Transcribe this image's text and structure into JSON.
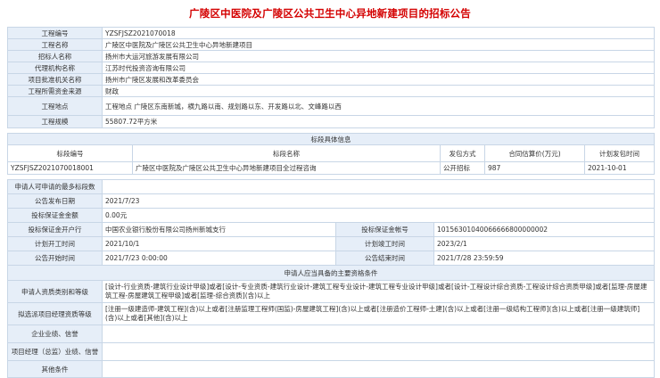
{
  "title": "广陵区中医院及广陵区公共卫生中心异地新建项目的招标公告",
  "info": [
    {
      "label": "工程编号",
      "value": "YZSFJSZ2021070018"
    },
    {
      "label": "工程名称",
      "value": "广陵区中医院及广陵区公共卫生中心异地新建项目"
    },
    {
      "label": "招标人名称",
      "value": "扬州市大运河旅游发展有限公司"
    },
    {
      "label": "代理机构名称",
      "value": "江苏时代投资咨询有限公司"
    },
    {
      "label": "项目批准机关名称",
      "value": "扬州市广陵区发展和改革委员会"
    },
    {
      "label": "工程所需资金来源",
      "value": "财政"
    },
    {
      "label": "工程地点",
      "value": "工程地点 广陵区东南新城，横九路以南、规划路以东、开发路以北、文峰路以西"
    },
    {
      "label": "工程规模",
      "value": "55807.72平方米"
    }
  ],
  "section_tender": "标段具体信息",
  "tender_headers": [
    "标段编号",
    "标段名称",
    "发包方式",
    "合同估算价(万元)",
    "计划发包时间"
  ],
  "tender_row": [
    "YZSFJSZ2021070018001",
    "广陵区中医院及广陵区公共卫生中心异地新建项目全过程咨询",
    "公开招标",
    "987",
    "2021-10-01"
  ],
  "max_bid": {
    "label": "申请人可申请的最多标段数",
    "value": ""
  },
  "publish_date": {
    "label": "公告发布日期",
    "value": "2021/7/23"
  },
  "bond_amount": {
    "label": "投标保证金金额",
    "value": "0.00元"
  },
  "bond_bank": {
    "label": "投标保证金开户行",
    "value": "中国农业银行股份有限公司扬州新城支行"
  },
  "bond_account": {
    "label": "投标保证金帐号",
    "value": "10156301040066666800000002"
  },
  "plan_start": {
    "label": "计划开工时间",
    "value": "2021/10/1"
  },
  "plan_end": {
    "label": "计划竣工时间",
    "value": "2023/2/1"
  },
  "notice_start": {
    "label": "公告开始时间",
    "value": "2021/7/23 0:00:00"
  },
  "notice_end": {
    "label": "公告结束时间",
    "value": "2021/7/28 23:59:59"
  },
  "section_qual": "申请人应当具备的主要资格条件",
  "qual_type": {
    "label": "申请人资质类别和等级",
    "value": "[设计-行业资质-建筑行业设计甲级]或者[设计-专业资质-建筑行业设计-建筑工程专业设计-建筑工程专业设计甲级]或者[设计-工程设计综合资质-工程设计综合资质甲级]或者[监理-房屋建筑工程-房屋建筑工程甲级]或者[监理-综合资质](含)以上"
  },
  "manager_qual": {
    "label": "拟选派项目经理资质等级",
    "value": "[注册一级建造师-建筑工程](含)以上或者[注册监理工程师(国监)-房屋建筑工程](含)以上或者[注册造价工程师-土建](含)以上或者[注册一级结构工程师](含)以上或者[注册一级建筑师](含)以上或者[其他](含)以上"
  },
  "performance": {
    "label": "企业业绩、信誉",
    "value": ""
  },
  "manager_performance": {
    "label": "项目经理（总监）业绩、信誉",
    "value": ""
  },
  "other": {
    "label": "其他条件",
    "value": ""
  }
}
